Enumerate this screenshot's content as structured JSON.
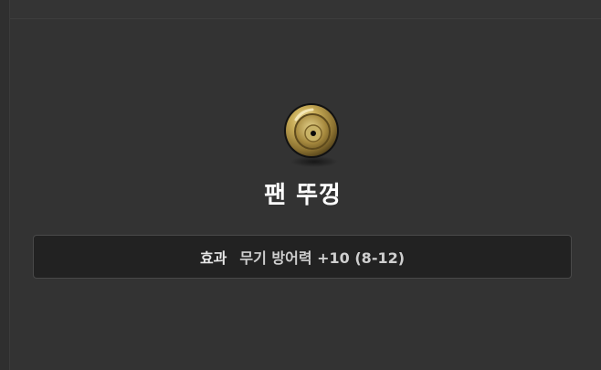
{
  "item": {
    "name": "팬 뚜껑",
    "icon": "shield-icon"
  },
  "effect": {
    "label": "효과",
    "value": "무기 방어력 +10 (8-12)"
  },
  "colors": {
    "background": "#333333",
    "effect_box": "#222222",
    "shield_gold": "#b89a45",
    "shield_dark": "#3a2d12"
  }
}
